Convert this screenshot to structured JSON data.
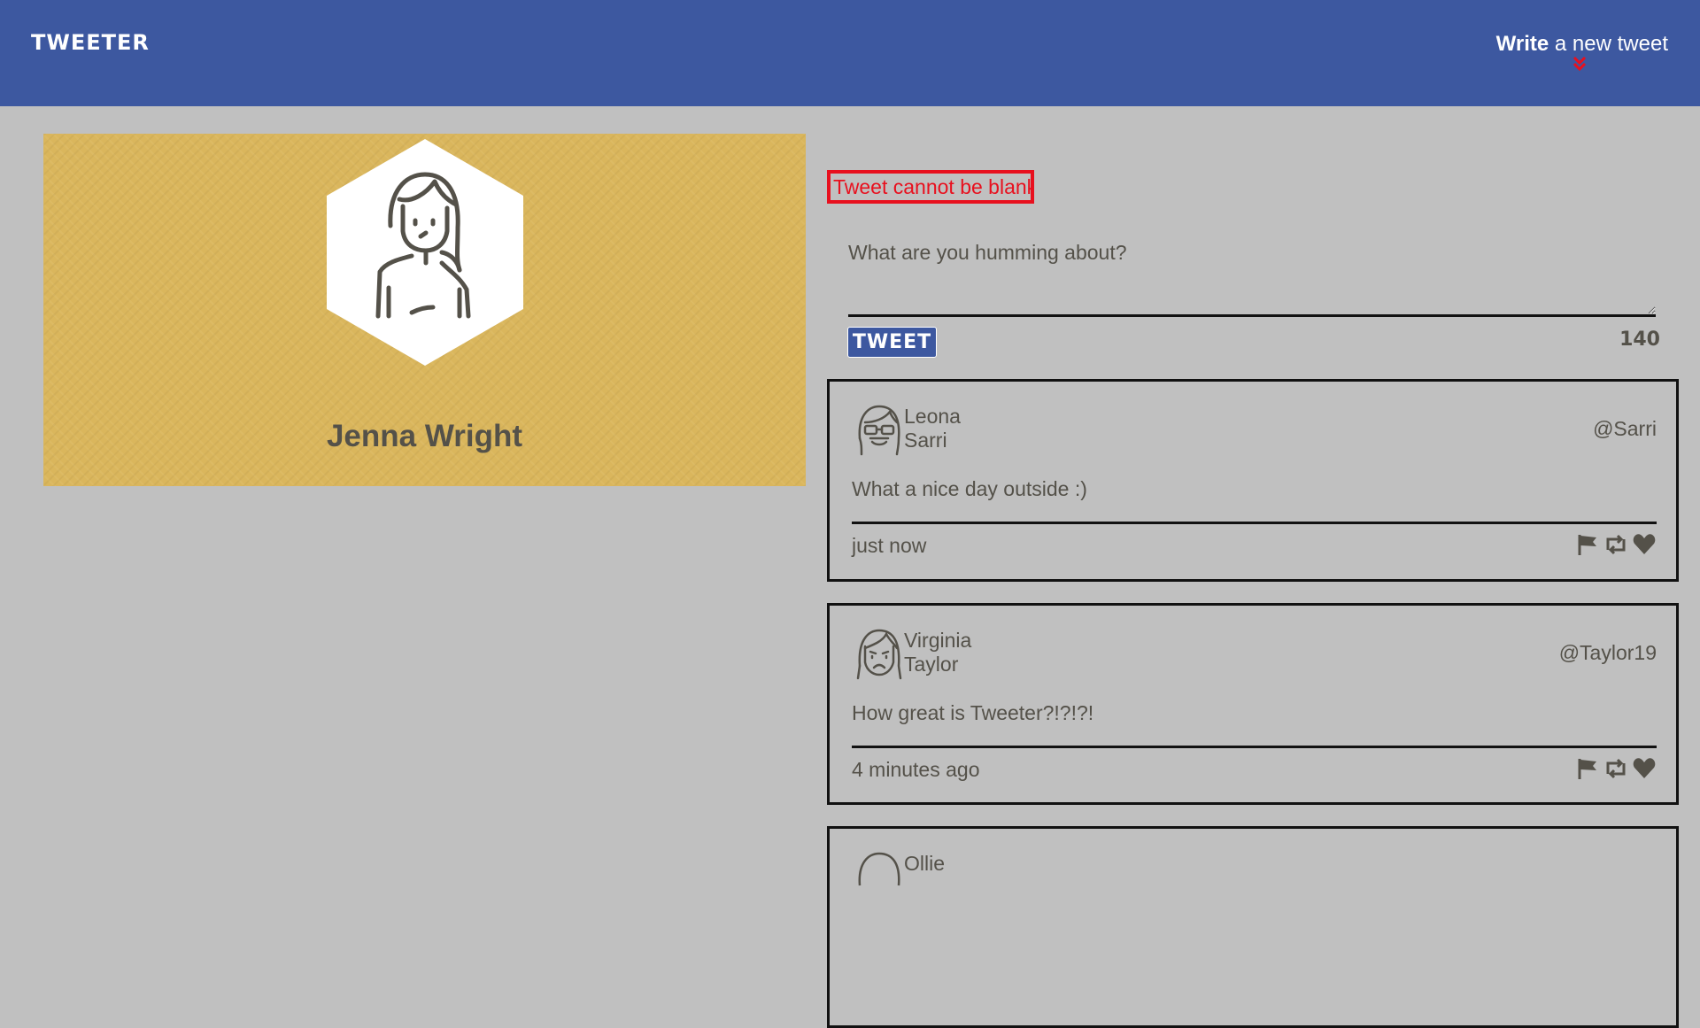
{
  "nav": {
    "logo": "TWEETER",
    "compose_bold": "Write",
    "compose_rest": " a new tweet",
    "compose_icon": "double-chevron-down-icon",
    "accent": "#e8101e"
  },
  "profile": {
    "name": "Jenna Wright",
    "avatar_icon": "girl-avatar-icon",
    "background": "#dab65c"
  },
  "composer": {
    "error": "Tweet cannot be blank!",
    "placeholder": "What are you humming about?",
    "button": "TWEET",
    "counter": "140"
  },
  "tweets": [
    {
      "first": "Leona",
      "last": "Sarri",
      "handle": "@Sarri",
      "text": "What a nice day outside :)",
      "time": "just now",
      "avatar_icon": "avatar-glasses-icon"
    },
    {
      "first": "Virginia",
      "last": "Taylor",
      "handle": "@Taylor19",
      "text": "How great is Tweeter?!?!?!",
      "time": "4 minutes ago",
      "avatar_icon": "avatar-frown-icon"
    },
    {
      "first": "Ollie",
      "last": "",
      "handle": "",
      "text": "",
      "time": "",
      "avatar_icon": "avatar-icon"
    }
  ],
  "actions": [
    "flag-icon",
    "retweet-icon",
    "heart-icon"
  ]
}
